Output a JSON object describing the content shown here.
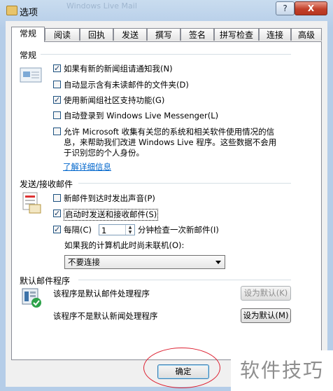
{
  "window": {
    "title": "选项",
    "ghost_title": "Windows Live Mail",
    "help_label": "?",
    "close_label": "X"
  },
  "tabs": [
    {
      "label": "常规",
      "active": true
    },
    {
      "label": "阅读"
    },
    {
      "label": "回执"
    },
    {
      "label": "发送"
    },
    {
      "label": "撰写"
    },
    {
      "label": "签名"
    },
    {
      "label": "拼写检查"
    },
    {
      "label": "连接"
    },
    {
      "label": "高级"
    }
  ],
  "general": {
    "title": "常规",
    "options": [
      {
        "label": "如果有新的新闻组请通知我(N)",
        "checked": true
      },
      {
        "label": "自动显示含有未读邮件的文件夹(D)",
        "checked": false
      },
      {
        "label": "使用新闻组社区支持功能(G)",
        "checked": true
      },
      {
        "label": "自动登录到 Windows Live Messenger(L)",
        "checked": false
      },
      {
        "label": "允许 Microsoft 收集有关您的系统和相关软件使用情况的信息，来帮助我们改进 Windows Live 程序。这些数据不会用于识别您的个人身份。",
        "checked": false
      }
    ],
    "learn_more": "了解详细信息"
  },
  "send_receive": {
    "title": "发送/接收邮件",
    "sound": {
      "label": "新邮件到达时发出声音(P)",
      "checked": false
    },
    "on_start": {
      "label": "启动时发送和接收邮件(S)",
      "checked": true
    },
    "every": {
      "label": "每隔(C)",
      "checked": true,
      "value": "1",
      "suffix": "分钟检查一次新邮件(I)"
    },
    "offline_label": "如果我的计算机此时尚未联机(O):",
    "offline_value": "不要连接"
  },
  "default_program": {
    "title": "默认邮件程序",
    "mail_text": "该程序是默认邮件处理程序",
    "mail_button": "设为默认(K)",
    "news_text": "该程序不是默认新闻处理程序",
    "news_button": "设为默认(M)"
  },
  "footer": {
    "ok": "确定"
  },
  "watermark": "软件技巧"
}
